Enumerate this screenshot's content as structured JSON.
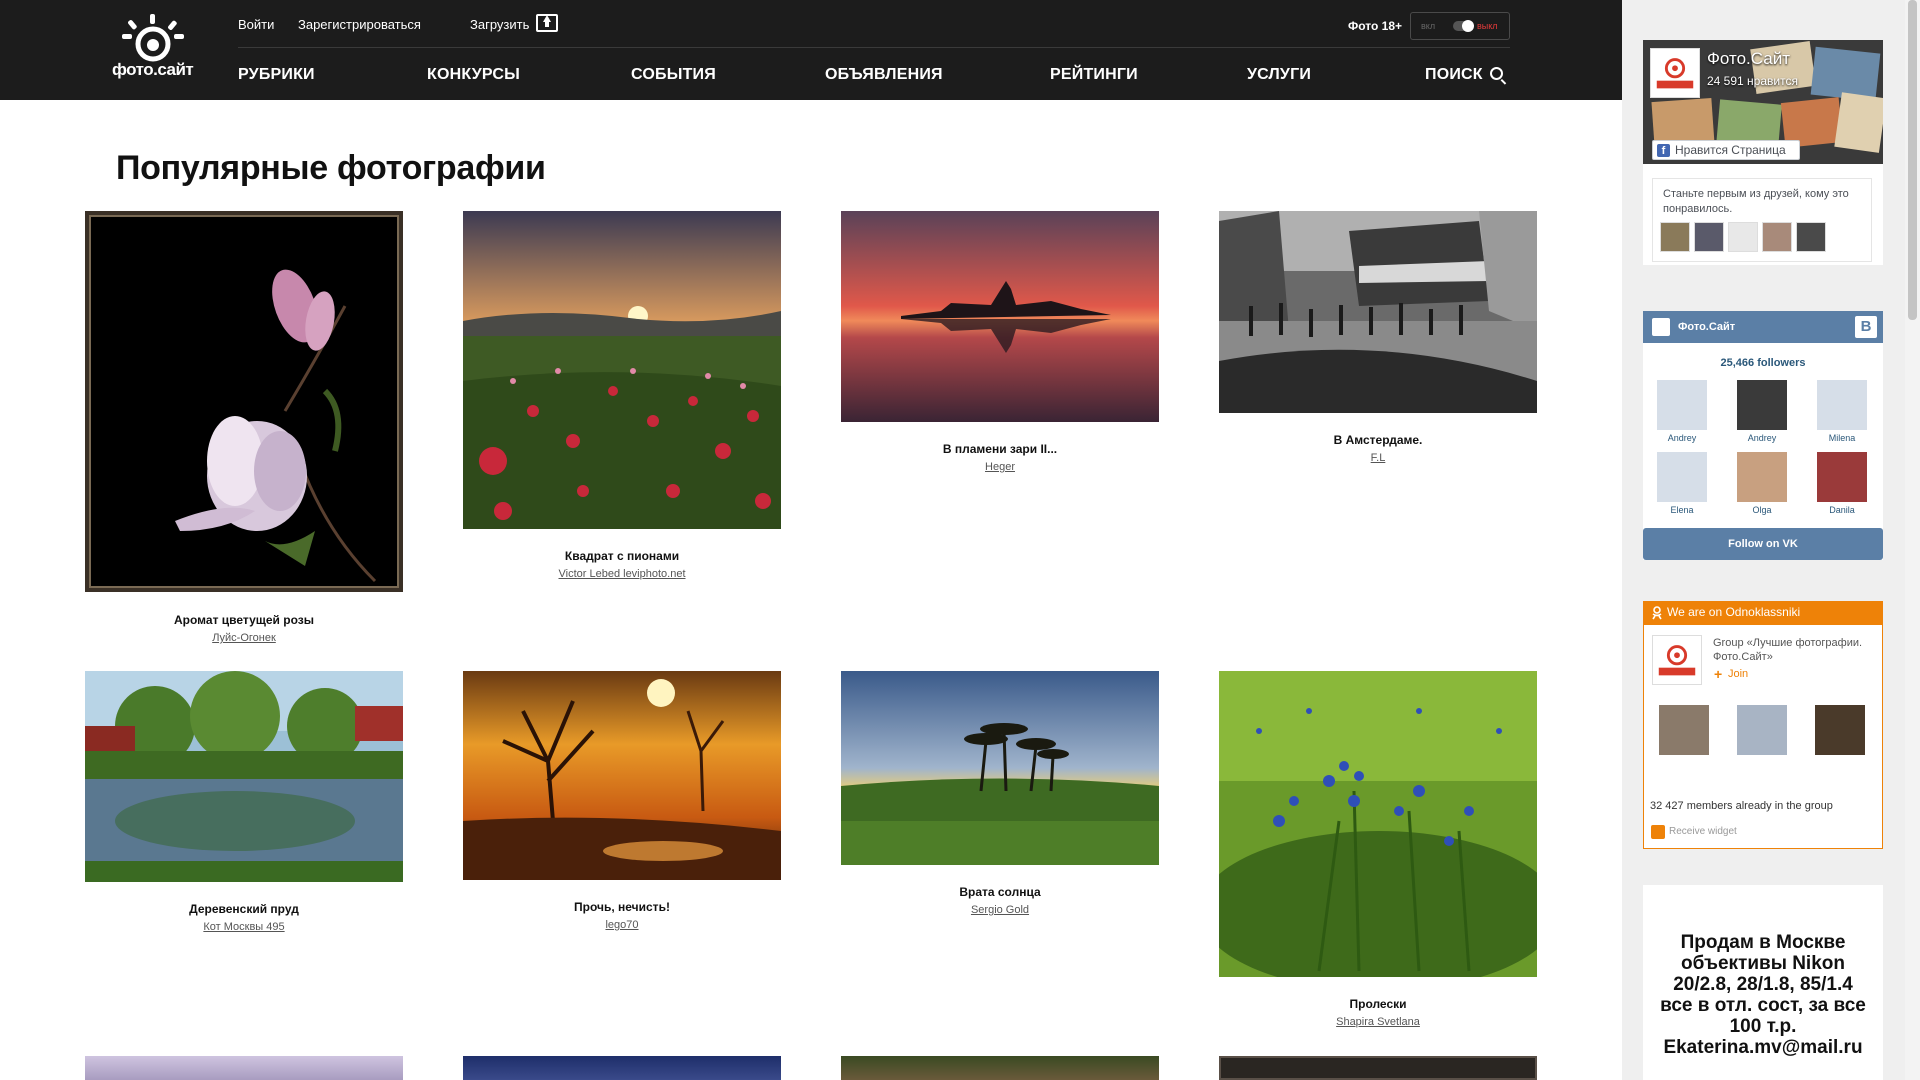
{
  "header": {
    "logo_text": "фото.сайт",
    "login_label": "Войти",
    "register_label": "Зарегистрироваться",
    "upload_label": "Загрузить",
    "adult_label": "Фото 18+",
    "toggle_on": "вкл",
    "toggle_off": "выкл",
    "nav": [
      {
        "label": "РУБРИКИ"
      },
      {
        "label": "КОНКУРСЫ"
      },
      {
        "label": "СОБЫТИЯ"
      },
      {
        "label": "ОБЪЯВЛЕНИЯ"
      },
      {
        "label": "РЕЙТИНГИ"
      },
      {
        "label": "УСЛУГИ"
      },
      {
        "label": "ПОИСК"
      }
    ]
  },
  "main": {
    "title": "Популярные фотографии",
    "photos": [
      {
        "title": "Аромат цветущей розы",
        "author": "Луйс-Огонек",
        "thumb": "rose"
      },
      {
        "title": "Квадрат с пионами",
        "author": "Victor Lebed leviphoto.net",
        "thumb": "peony-field"
      },
      {
        "title": "В пламени зари II...",
        "author": "Heger",
        "thumb": "sunset-church"
      },
      {
        "title": "В Амстердаме.",
        "author": "F.L",
        "thumb": "amsterdam-street"
      },
      {
        "title": "Деревенский пруд",
        "author": "Кот Москвы 495",
        "thumb": "village-pond"
      },
      {
        "title": "Прочь, нечисть!",
        "author": "lego70",
        "thumb": "misty-sunrise"
      },
      {
        "title": "Врата солнца",
        "author": "Sergio Gold",
        "thumb": "palm-sunset"
      },
      {
        "title": "Пролески",
        "author": "Shapira Svetlana",
        "thumb": "blue-flowers"
      }
    ]
  },
  "sidebar": {
    "facebook": {
      "page_name": "Фото.Сайт",
      "likes": "24 591 нравится",
      "like_button": "Нравится Страница",
      "friends_text": "Станьте первым из друзей, кому это понравилось."
    },
    "vk": {
      "title": "Фото.Сайт",
      "badge": "В",
      "followers": "25,466 followers",
      "members": [
        {
          "name": "Andrey"
        },
        {
          "name": "Andrey"
        },
        {
          "name": "Milena"
        },
        {
          "name": "Elena"
        },
        {
          "name": "Olga"
        },
        {
          "name": "Danila"
        }
      ],
      "follow_button": "Follow on VK"
    },
    "odnoklassniki": {
      "header": "We are on Odnoklassniki",
      "group": "Group «Лучшие фотографии. Фото.Сайт»",
      "join": "Join",
      "members": "32 427 members already in the group",
      "receive": "Receive widget"
    },
    "ad": {
      "text": "Продам в Москве объективы Nikon 20/2.8, 28/1.8, 85/1.4 все в отл. сост, за все 100 т.р. Ekaterina.mv@mail.ru"
    }
  },
  "colors": {
    "header_bg": "#1c1c1c",
    "vk_blue": "#5b7fa6",
    "ok_orange": "#ee8208",
    "fb_blue": "#4267b2"
  }
}
